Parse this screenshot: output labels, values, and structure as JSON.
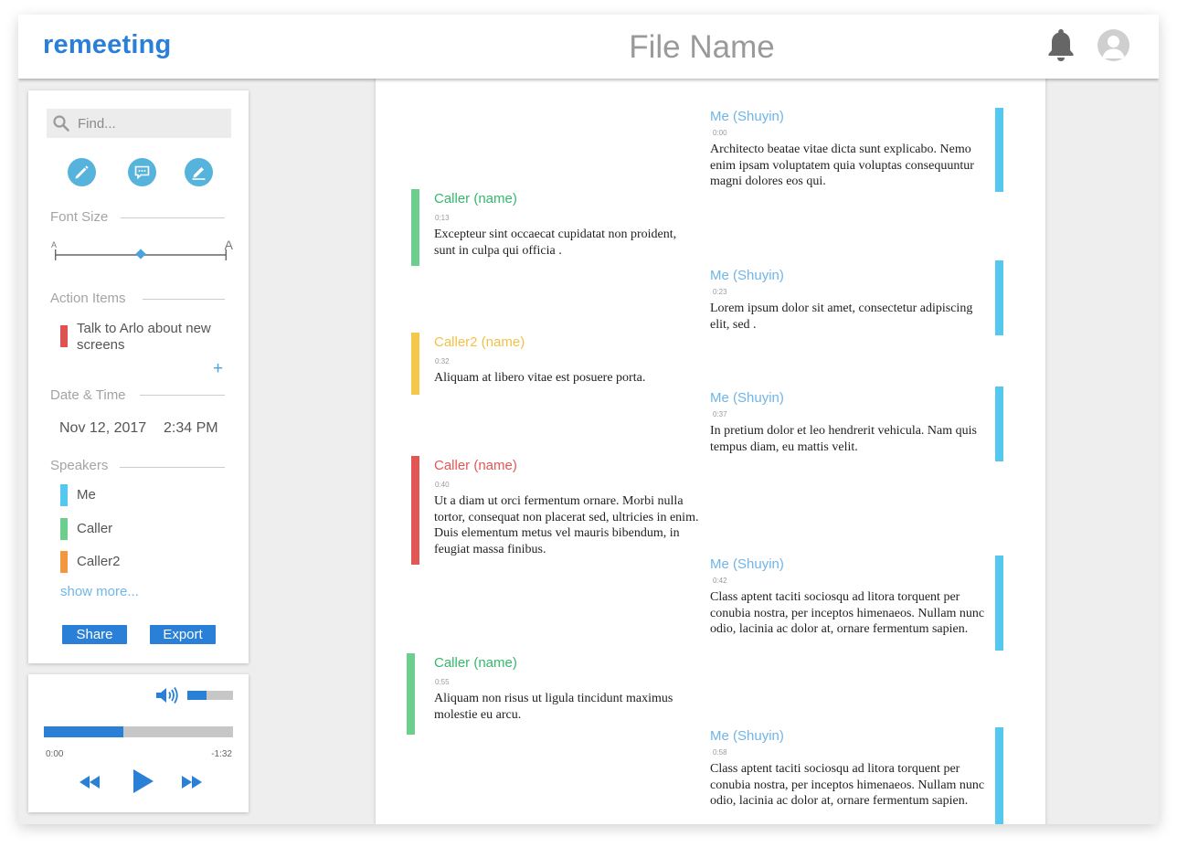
{
  "app": {
    "logo": "remeeting",
    "file_name": "File Name"
  },
  "colors": {
    "me": "#55c8f0",
    "caller": "#6dcf8e",
    "caller2": "#f4c94b",
    "caller_red": "#e35656",
    "accent": "#2980d6"
  },
  "sidebar": {
    "search_placeholder": "Find...",
    "tools": [
      "pencil-icon",
      "comment-icon",
      "highlighter-icon"
    ],
    "font_size_label": "Font Size",
    "font_size_small": "A",
    "font_size_large": "A",
    "font_size_level": 0.5,
    "action_items_label": "Action Items",
    "action_items": [
      {
        "text": "Talk to Arlo about new screens",
        "color": "#e05252"
      }
    ],
    "add_action": "+",
    "date_time_label": "Date & Time",
    "date": "Nov 12, 2017",
    "time": "2:34 PM",
    "speakers_label": "Speakers",
    "speakers": [
      {
        "name": "Me",
        "color": "#55c8f0"
      },
      {
        "name": "Caller",
        "color": "#6dcf8e"
      },
      {
        "name": "Caller2",
        "color": "#f3963e"
      }
    ],
    "show_more": "show more...",
    "share": "Share",
    "export": "Export"
  },
  "player": {
    "volume_level": 0.42,
    "progress": 0.42,
    "elapsed": "0:00",
    "remaining": "-1:32"
  },
  "transcript": [
    {
      "side": "right",
      "speaker": "Me (Shuyin)",
      "time": "0:00",
      "text": "Architecto beatae vitae dicta sunt explicabo. Nemo enim ipsam voluptatem quia voluptas consequuntur magni dolores eos qui."
    },
    {
      "side": "left",
      "speaker": "Caller (name)",
      "time": "0:13",
      "text": "Excepteur sint occaecat cupidatat non proident, sunt in culpa qui officia ."
    },
    {
      "side": "right",
      "speaker": "Me (Shuyin)",
      "time": "0:23",
      "text": "Lorem ipsum dolor sit amet, consectetur adipiscing elit, sed ."
    },
    {
      "side": "left",
      "speaker": "Caller2 (name)",
      "time": "0:32",
      "text": "Aliquam at libero vitae est posuere porta."
    },
    {
      "side": "right",
      "speaker": "Me (Shuyin)",
      "time": "0:37",
      "text": "In pretium dolor et leo hendrerit vehicula. Nam quis tempus diam, eu mattis velit."
    },
    {
      "side": "left",
      "speaker": "Caller (name)",
      "time": "0:40",
      "text": "Ut a diam ut orci fermentum ornare. Morbi nulla tortor, consequat non placerat sed, ultricies in enim. Duis elementum metus vel mauris bibendum, in feugiat massa finibus."
    },
    {
      "side": "right",
      "speaker": "Me (Shuyin)",
      "time": "0:42",
      "text": "Class aptent taciti sociosqu ad litora torquent per conubia nostra, per inceptos himenaeos. Nullam nunc odio, lacinia ac dolor at, ornare fermentum sapien."
    },
    {
      "side": "left",
      "speaker": "Caller (name)",
      "time": "0:55",
      "text": "Aliquam non risus ut ligula tincidunt maximus molestie eu arcu."
    },
    {
      "side": "right",
      "speaker": "Me (Shuyin)",
      "time": "0:58",
      "text": "Class aptent taciti sociosqu ad litora torquent per conubia nostra, per inceptos himenaeos. Nullam nunc odio, lacinia ac dolor at, ornare fermentum sapien."
    }
  ]
}
